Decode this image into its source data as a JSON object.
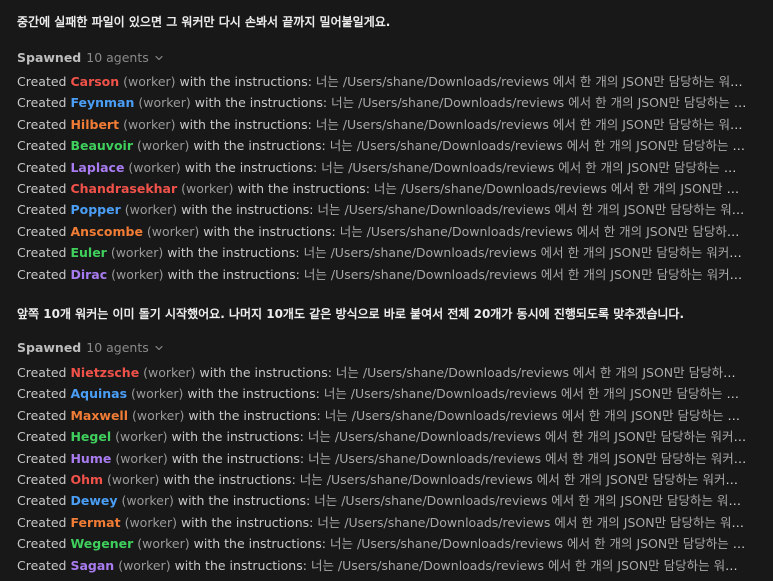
{
  "messages": {
    "first": "중간에 실패한 파일이 있으면 그 워커만 다시 손봐서 끝까지 밀어붙일게요.",
    "second": "앞쪽 10개 워커는 이미 돌기 시작했어요. 나머지 10개도 같은 방식으로 바로 붙여서 전체 20개가 동시에 진행되도록 맞추겠습니다."
  },
  "groups": [
    {
      "spawned_label": "Spawned",
      "spawned_count": "10 agents",
      "agents": [
        {
          "created": "Created",
          "name": "Carson",
          "color": "#f0524a",
          "role": "(worker)",
          "with": "with the instructions:",
          "instructions": "너는 /Users/shane/Downloads/reviews 에서 한 개의 JSON만 담당하는 워커...."
        },
        {
          "created": "Created",
          "name": "Feynman",
          "color": "#4b9ef5",
          "role": "(worker)",
          "with": "with the instructions:",
          "instructions": "너는 /Users/shane/Downloads/reviews 에서 한 개의 JSON만 담당하는 워커...."
        },
        {
          "created": "Created",
          "name": "Hilbert",
          "color": "#f07c35",
          "role": "(worker)",
          "with": "with the instructions:",
          "instructions": "너는 /Users/shane/Downloads/reviews 에서 한 개의 JSON만 담당하는 워커다...."
        },
        {
          "created": "Created",
          "name": "Beauvoir",
          "color": "#3fcf5c",
          "role": "(worker)",
          "with": "with the instructions:",
          "instructions": "너는 /Users/shane/Downloads/reviews 에서 한 개의 JSON만 담당하는 워커다...."
        },
        {
          "created": "Created",
          "name": "Laplace",
          "color": "#a87cf0",
          "role": "(worker)",
          "with": "with the instructions:",
          "instructions": "너는 /Users/shane/Downloads/reviews 에서 한 개의 JSON만 담당하는 워커..."
        },
        {
          "created": "Created",
          "name": "Chandrasekhar",
          "color": "#f0524a",
          "role": "(worker)",
          "with": "with the instructions:",
          "instructions": "너는 /Users/shane/Downloads/reviews 에서 한 개의 JSON만 담당하..."
        },
        {
          "created": "Created",
          "name": "Popper",
          "color": "#4b9ef5",
          "role": "(worker)",
          "with": "with the instructions:",
          "instructions": "너는 /Users/shane/Downloads/reviews 에서 한 개의 JSON만 담당하는 워커다...."
        },
        {
          "created": "Created",
          "name": "Anscombe",
          "color": "#f07c35",
          "role": "(worker)",
          "with": "with the instructions:",
          "instructions": "너는 /Users/shane/Downloads/reviews 에서 한 개의 JSON만 담당하는 워커..."
        },
        {
          "created": "Created",
          "name": "Euler",
          "color": "#3fcf5c",
          "role": "(worker)",
          "with": "with the instructions:",
          "instructions": "너는 /Users/shane/Downloads/reviews 에서 한 개의 JSON만 담당하는 워커다. ..."
        },
        {
          "created": "Created",
          "name": "Dirac",
          "color": "#a87cf0",
          "role": "(worker)",
          "with": "with the instructions:",
          "instructions": "너는 /Users/shane/Downloads/reviews 에서 한 개의 JSON만 담당하는 워커다. ..."
        }
      ]
    },
    {
      "spawned_label": "Spawned",
      "spawned_count": "10 agents",
      "agents": [
        {
          "created": "Created",
          "name": "Nietzsche",
          "color": "#f0524a",
          "role": "(worker)",
          "with": "with the instructions:",
          "instructions": "너는 /Users/shane/Downloads/reviews 에서 한 개의 JSON만 담당하는 워커..."
        },
        {
          "created": "Created",
          "name": "Aquinas",
          "color": "#4b9ef5",
          "role": "(worker)",
          "with": "with the instructions:",
          "instructions": "너는 /Users/shane/Downloads/reviews 에서 한 개의 JSON만 담당하는 워커..."
        },
        {
          "created": "Created",
          "name": "Maxwell",
          "color": "#f07c35",
          "role": "(worker)",
          "with": "with the instructions:",
          "instructions": "너는 /Users/shane/Downloads/reviews 에서 한 개의 JSON만 담당하는 워커..."
        },
        {
          "created": "Created",
          "name": "Hegel",
          "color": "#3fcf5c",
          "role": "(worker)",
          "with": "with the instructions:",
          "instructions": "너는 /Users/shane/Downloads/reviews 에서 한 개의 JSON만 담당하는 워커다. ..."
        },
        {
          "created": "Created",
          "name": "Hume",
          "color": "#a87cf0",
          "role": "(worker)",
          "with": "with the instructions:",
          "instructions": "너는 /Users/shane/Downloads/reviews 에서 한 개의 JSON만 담당하는 워커다. ..."
        },
        {
          "created": "Created",
          "name": "Ohm",
          "color": "#f0524a",
          "role": "(worker)",
          "with": "with the instructions:",
          "instructions": "너는 /Users/shane/Downloads/reviews 에서 한 개의 JSON만 담당하는 워커다. 다..."
        },
        {
          "created": "Created",
          "name": "Dewey",
          "color": "#4b9ef5",
          "role": "(worker)",
          "with": "with the instructions:",
          "instructions": "너는 /Users/shane/Downloads/reviews 에서 한 개의 JSON만 담당하는 워커다. ..."
        },
        {
          "created": "Created",
          "name": "Fermat",
          "color": "#f07c35",
          "role": "(worker)",
          "with": "with the instructions:",
          "instructions": "너는 /Users/shane/Downloads/reviews 에서 한 개의 JSON만 담당하는 워커다...."
        },
        {
          "created": "Created",
          "name": "Wegener",
          "color": "#3fcf5c",
          "role": "(worker)",
          "with": "with the instructions:",
          "instructions": "너는 /Users/shane/Downloads/reviews 에서 한 개의 JSON만 담당하는 워커..."
        },
        {
          "created": "Created",
          "name": "Sagan",
          "color": "#a87cf0",
          "role": "(worker)",
          "with": "with the instructions:",
          "instructions": "너는 /Users/shane/Downloads/reviews 에서 한 개의 JSON만 담당하는 워커다...."
        }
      ]
    }
  ]
}
